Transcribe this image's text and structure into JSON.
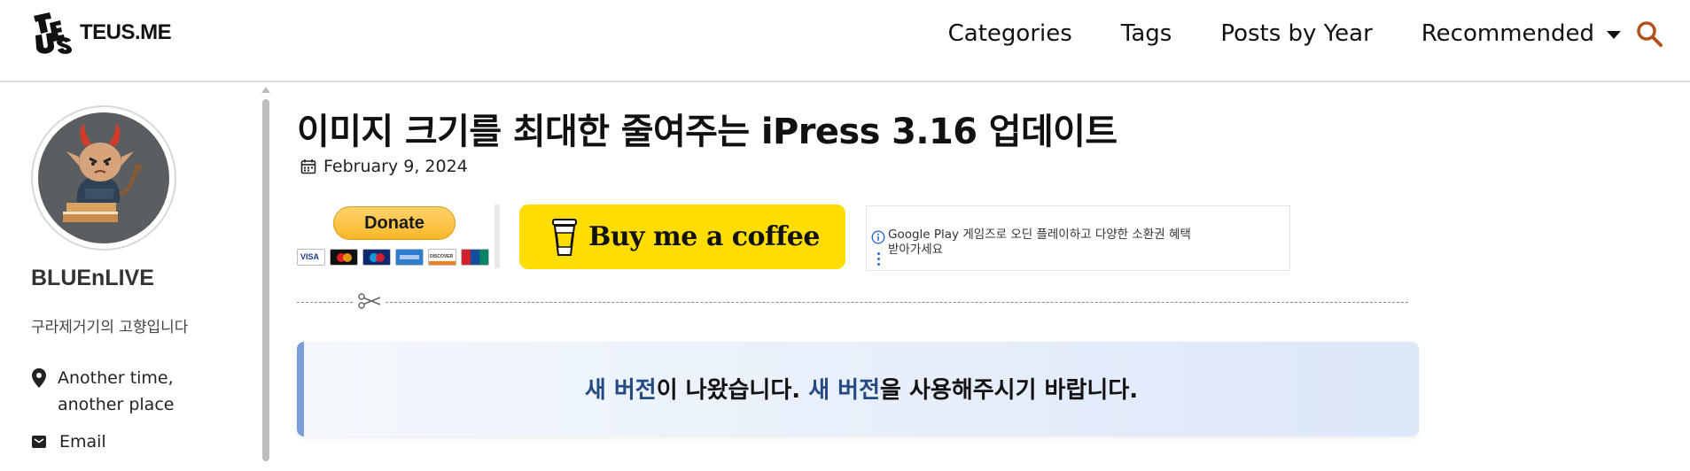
{
  "header": {
    "logo_text": "TEUS.ME",
    "logo_mark": "TEUS",
    "nav": [
      {
        "label": "Categories"
      },
      {
        "label": "Tags"
      },
      {
        "label": "Posts by Year"
      },
      {
        "label": "Recommended"
      }
    ],
    "search_icon": "search-icon"
  },
  "sidebar": {
    "name": "BLUEnLIVE",
    "description": "구라제거기의 고향입니다",
    "location_line1": "Another time,",
    "location_line2": "another place",
    "email_label": "Email"
  },
  "post": {
    "title": "이미지 크기를 최대한 줄여주는 iPress 3.16 업데이트",
    "date": "February 9, 2024"
  },
  "support": {
    "paypal_label": "Donate",
    "coffee_label": "Buy me a coffee",
    "card_labels": [
      "VISA",
      "DISCOVER"
    ]
  },
  "ad": {
    "line1": "Google Play 게임즈로 오딘 플레이하고 다양한 소환권 혜택",
    "line2": "받아가세요"
  },
  "notice": {
    "seg1": "새 버전",
    "seg2": "이 나왔습니다. ",
    "seg3": "새 버전",
    "seg4": "을 사용해주시기 바랍니다."
  },
  "colors": {
    "accent": "#b0521a",
    "link_highlight": "#234a82",
    "coffee_yellow": "#ffdd00",
    "notice_border": "#7a9fd8"
  }
}
